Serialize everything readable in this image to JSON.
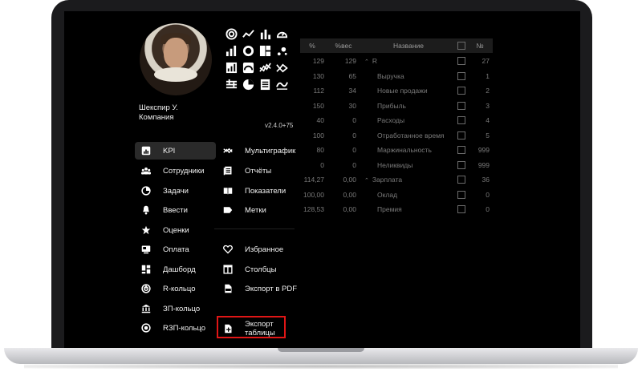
{
  "profile": {
    "name": "Шекспир У.",
    "company": "Компания",
    "version": "v2.4.0+75"
  },
  "top_icons": [
    "radial-chart-icon",
    "line-chart-icon",
    "bar-chart-icon",
    "gauge-icon",
    "bar-chart-small-icon",
    "donut-icon",
    "layout-icon",
    "scatter-icon",
    "bar-chart-up-icon",
    "speed-icon",
    "multiline-icon",
    "multiline-cross-icon",
    "sliders-icon",
    "pie-icon",
    "report-icon",
    "wave-chart-icon"
  ],
  "menu": {
    "left": [
      {
        "label": "KPI",
        "icon": "kpi-icon",
        "active": true
      },
      {
        "label": "Сотрудники",
        "icon": "employees-icon"
      },
      {
        "label": "Задачи",
        "icon": "tasks-icon"
      },
      {
        "label": "Ввести",
        "icon": "bell-icon"
      },
      {
        "label": "Оценки",
        "icon": "star-icon"
      },
      {
        "label": "Оплата",
        "icon": "payment-icon"
      },
      {
        "label": "Дашборд",
        "icon": "dashboard-icon"
      },
      {
        "label": "R-кольцо",
        "icon": "r-ring-icon"
      },
      {
        "label": "ЗП-кольцо",
        "icon": "bank-icon"
      },
      {
        "label": "RЗП-кольцо",
        "icon": "radio-icon"
      }
    ],
    "right": [
      {
        "label": "Мультиграфик",
        "icon": "multichart-icon"
      },
      {
        "label": "Отчёты",
        "icon": "reports-icon"
      },
      {
        "label": "Показатели",
        "icon": "book-icon"
      },
      {
        "label": "Метки",
        "icon": "tag-icon"
      },
      {
        "label": "Избранное",
        "icon": "heart-icon"
      },
      {
        "label": "Столбцы",
        "icon": "columns-icon"
      },
      {
        "label": "Экспорт в PDF",
        "icon": "pdf-icon"
      },
      {
        "label": "Экспорт таблицы",
        "label_line1": "Экспорт",
        "label_line2": "таблицы",
        "icon": "export-table-icon"
      }
    ]
  },
  "table": {
    "headers": {
      "pct": "%",
      "weight": "%вес",
      "name": "Название",
      "num": "№"
    },
    "rows": [
      {
        "pct": "129",
        "weight": "129",
        "name": "R",
        "num": "27",
        "group": true
      },
      {
        "pct": "130",
        "weight": "65",
        "name": "Выручка",
        "num": "1"
      },
      {
        "pct": "112",
        "weight": "34",
        "name": "Новые продажи",
        "num": "2"
      },
      {
        "pct": "150",
        "weight": "30",
        "name": "Прибыль",
        "num": "3"
      },
      {
        "pct": "40",
        "weight": "0",
        "name": "Расходы",
        "num": "4"
      },
      {
        "pct": "100",
        "weight": "0",
        "name": "Отработанное время",
        "num": "5"
      },
      {
        "pct": "80",
        "weight": "0",
        "name": "Маржинальность",
        "num": "999"
      },
      {
        "pct": "0",
        "weight": "0",
        "name": "Неликвиды",
        "num": "999"
      },
      {
        "pct": "114,27",
        "weight": "0,00",
        "name": "Зарплата",
        "num": "36",
        "group": true
      },
      {
        "pct": "100,00",
        "weight": "0,00",
        "name": "Оклад",
        "num": "0"
      },
      {
        "pct": "128,53",
        "weight": "0,00",
        "name": "Премия",
        "num": "0"
      }
    ]
  },
  "colors": {
    "screen_bg": "#000000",
    "highlight": "#e01616",
    "active_bg": "#2a2a2a"
  }
}
